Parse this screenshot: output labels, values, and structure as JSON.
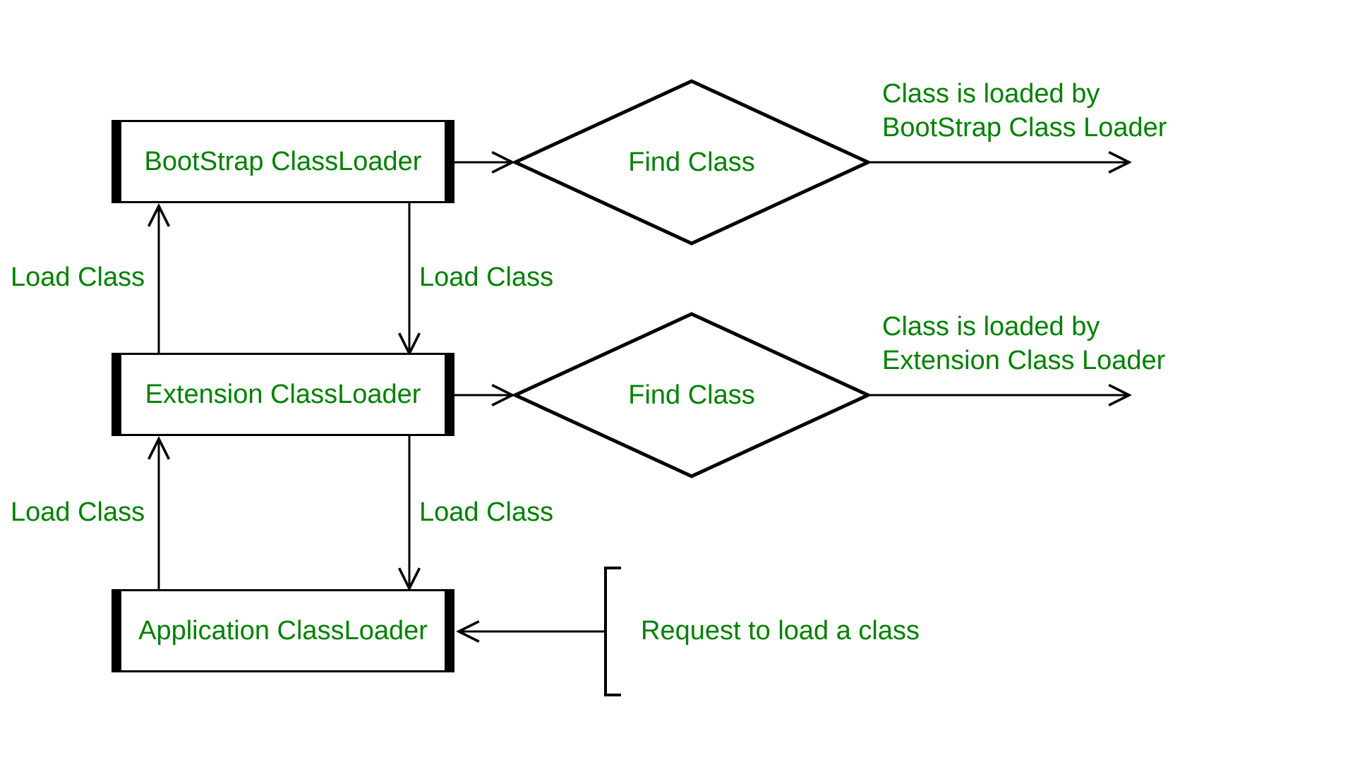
{
  "boxes": {
    "bootstrap": "BootStrap ClassLoader",
    "extension": "Extension ClassLoader",
    "application": "Application ClassLoader"
  },
  "diamonds": {
    "find1": "Find Class",
    "find2": "Find Class"
  },
  "labels": {
    "loadclass_up1": "Load Class",
    "loadclass_down1": "Load Class",
    "loadclass_up2": "Load Class",
    "loadclass_down2": "Load Class",
    "request": "Request to load a class",
    "result1_line1": "Class is loaded by",
    "result1_line2": "BootStrap Class Loader",
    "result2_line1": "Class is loaded by",
    "result2_line2": "Extension Class Loader"
  },
  "colors": {
    "text": "#008000",
    "stroke": "#000000"
  }
}
